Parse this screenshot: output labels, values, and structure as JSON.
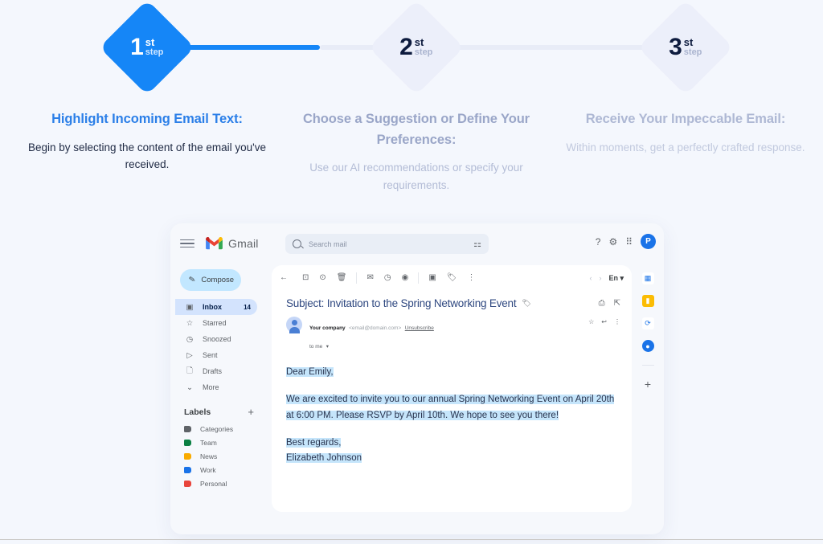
{
  "steps": [
    {
      "num": "1",
      "suffix": "st",
      "word": "step",
      "state": "active",
      "title": "Highlight Incoming Email Text:",
      "desc": "Begin by selecting the content of the email you've received."
    },
    {
      "num": "2",
      "suffix": "st",
      "word": "step",
      "state": "inactive",
      "title": "Choose a Suggestion or Define Your Preferences:",
      "desc": "Use our AI recommendations or specify your requirements."
    },
    {
      "num": "3",
      "suffix": "st",
      "word": "step",
      "state": "inactive",
      "title": "Receive Your Impeccable Email:",
      "desc": "Within moments, get a perfectly crafted response."
    }
  ],
  "colors": {
    "page_background": "#f4f7fd",
    "accent_blue": "#1586f7",
    "step_inactive": "#eceffa",
    "connector_grey": "#e8ecf7",
    "highlight": "#c5e5fb",
    "gmail_surface": "#f6f8fc",
    "compose_blue": "#c2e7ff",
    "nav_active": "#d3e3fd"
  },
  "gmail": {
    "header": {
      "menu_icon": "hamburger-icon",
      "logo_icon": "gmail-logo-icon",
      "brand": "Gmail",
      "search": {
        "placeholder": "Search mail",
        "search_icon": "search-icon",
        "options_icon": "tune-icon",
        "value": ""
      },
      "help_icon": "help-circle-icon",
      "settings_icon": "gear-icon",
      "apps_icon": "apps-grid-icon",
      "avatar_initial": "P"
    },
    "sidebar": {
      "compose": {
        "label": "Compose",
        "icon": "pencil-icon"
      },
      "nav": [
        {
          "label": "Inbox",
          "icon": "inbox-icon",
          "count": "14",
          "active": true
        },
        {
          "label": "Starred",
          "icon": "star-icon",
          "count": "",
          "active": false
        },
        {
          "label": "Snoozed",
          "icon": "clock-icon",
          "count": "",
          "active": false
        },
        {
          "label": "Sent",
          "icon": "send-icon",
          "count": "",
          "active": false
        },
        {
          "label": "Drafts",
          "icon": "file-icon",
          "count": "",
          "active": false
        },
        {
          "label": "More",
          "icon": "chevron-down-icon",
          "count": "",
          "active": false
        }
      ],
      "labels_header": {
        "title": "Labels",
        "add_icon": "plus-icon"
      },
      "labels": [
        {
          "label": "Categories",
          "color": "#5f6368"
        },
        {
          "label": "Team",
          "color": "#0b8043"
        },
        {
          "label": "News",
          "color": "#f9ab00"
        },
        {
          "label": "Work",
          "color": "#1a73e8"
        },
        {
          "label": "Personal",
          "color": "#e8453c"
        }
      ]
    },
    "toolbar": {
      "back_icon": "arrow-left-icon",
      "icons": [
        "archive-icon",
        "report-spam-icon",
        "delete-icon",
        "mark-unread-icon",
        "snooze-icon",
        "add-task-icon",
        "move-to-icon",
        "label-icon",
        "more-vert-icon"
      ],
      "prev_icon": "chevron-left-icon",
      "next_icon": "chevron-right-icon",
      "language": "En",
      "language_caret": "▾"
    },
    "email": {
      "subject": "Subject: Invitation to the Spring Networking Event",
      "subject_tag_icon": "label-icon",
      "print_icon": "print-icon",
      "popout_icon": "open-in-new-icon",
      "sender_name": "Your company",
      "sender_address": "<email@domain.com>",
      "unsubscribe": "Unsubscribe",
      "recipient": "to me",
      "recipient_caret": "▾",
      "star_icon": "star-icon",
      "reply_icon": "reply-icon",
      "more_icon": "more-vert-icon",
      "body": [
        "Dear Emily,",
        "We are excited to invite you to our annual Spring Networking Event on April 20th at 6:00 PM. Please RSVP by April 10th. We hope to see you there!",
        "Best regards,",
        "Elizabeth Johnson"
      ]
    },
    "rail": [
      {
        "name": "calendar-icon",
        "glyph": "▤",
        "bg": "#ffffff",
        "fg": "#1a73e8"
      },
      {
        "name": "keep-icon",
        "glyph": "▮",
        "bg": "#fbbc04",
        "fg": "#ffffff"
      },
      {
        "name": "tasks-icon",
        "glyph": "⟳",
        "bg": "#ffffff",
        "fg": "#1a73e8"
      },
      {
        "name": "contacts-icon",
        "glyph": "●",
        "bg": "#1a73e8",
        "fg": "#ffffff"
      }
    ],
    "rail_add": "+"
  }
}
